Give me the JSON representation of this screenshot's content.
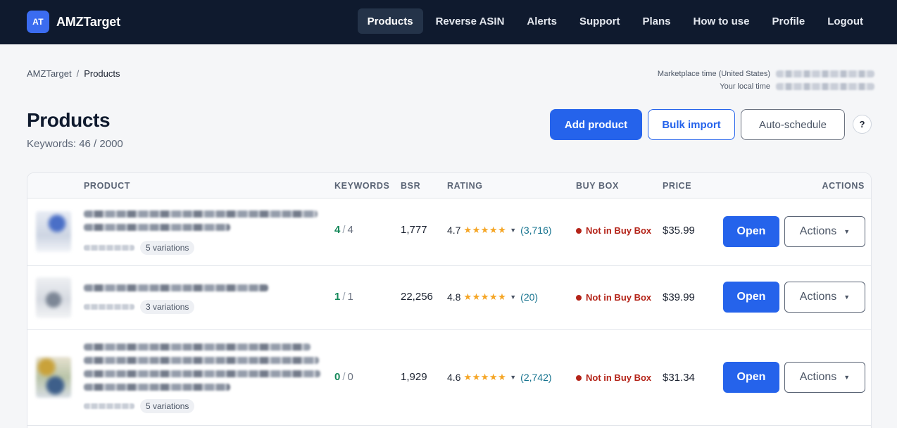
{
  "navbar": {
    "logo_text": "AT",
    "brand": "AMZTarget",
    "items": [
      {
        "label": "Products",
        "active": true
      },
      {
        "label": "Reverse ASIN",
        "active": false
      },
      {
        "label": "Alerts",
        "active": false
      },
      {
        "label": "Support",
        "active": false
      },
      {
        "label": "Plans",
        "active": false
      },
      {
        "label": "How to use",
        "active": false
      },
      {
        "label": "Profile",
        "active": false
      },
      {
        "label": "Logout",
        "active": false
      }
    ]
  },
  "breadcrumb": {
    "root": "AMZTarget",
    "separator": "/",
    "current": "Products"
  },
  "times": {
    "marketplace_label": "Marketplace time (United States)",
    "local_label": "Your local time"
  },
  "header": {
    "title": "Products",
    "keywords_text": "Keywords: 46 / 2000",
    "add_button": "Add product",
    "bulk_button": "Bulk import",
    "auto_button": "Auto-schedule",
    "help_button": "?"
  },
  "table": {
    "columns": [
      "PRODUCT",
      "KEYWORDS",
      "BSR",
      "RATING",
      "BUY BOX",
      "PRICE",
      "ACTIONS"
    ],
    "open_label": "Open",
    "actions_label": "Actions",
    "rows": [
      {
        "variations": "5 variations",
        "kw_tracked": "4",
        "kw_total": "4",
        "bsr": "1,777",
        "rating": "4.7",
        "stars": "★★★★★",
        "reviews": "(3,716)",
        "buy_box": "Not in Buy Box",
        "price": "$35.99"
      },
      {
        "variations": "3 variations",
        "kw_tracked": "1",
        "kw_total": "1",
        "bsr": "22,256",
        "rating": "4.8",
        "stars": "★★★★★",
        "reviews": "(20)",
        "buy_box": "Not in Buy Box",
        "price": "$39.99"
      },
      {
        "variations": "5 variations",
        "kw_tracked": "0",
        "kw_total": "0",
        "bsr": "1,929",
        "rating": "4.6",
        "stars": "★★★★★",
        "reviews": "(2,742)",
        "buy_box": "Not in Buy Box",
        "price": "$31.34"
      }
    ]
  },
  "colors": {
    "nav_bg": "#0f1a2e",
    "primary": "#2563eb",
    "success": "#15885a",
    "danger": "#b42318",
    "star": "#f5a524",
    "link": "#16738f"
  }
}
